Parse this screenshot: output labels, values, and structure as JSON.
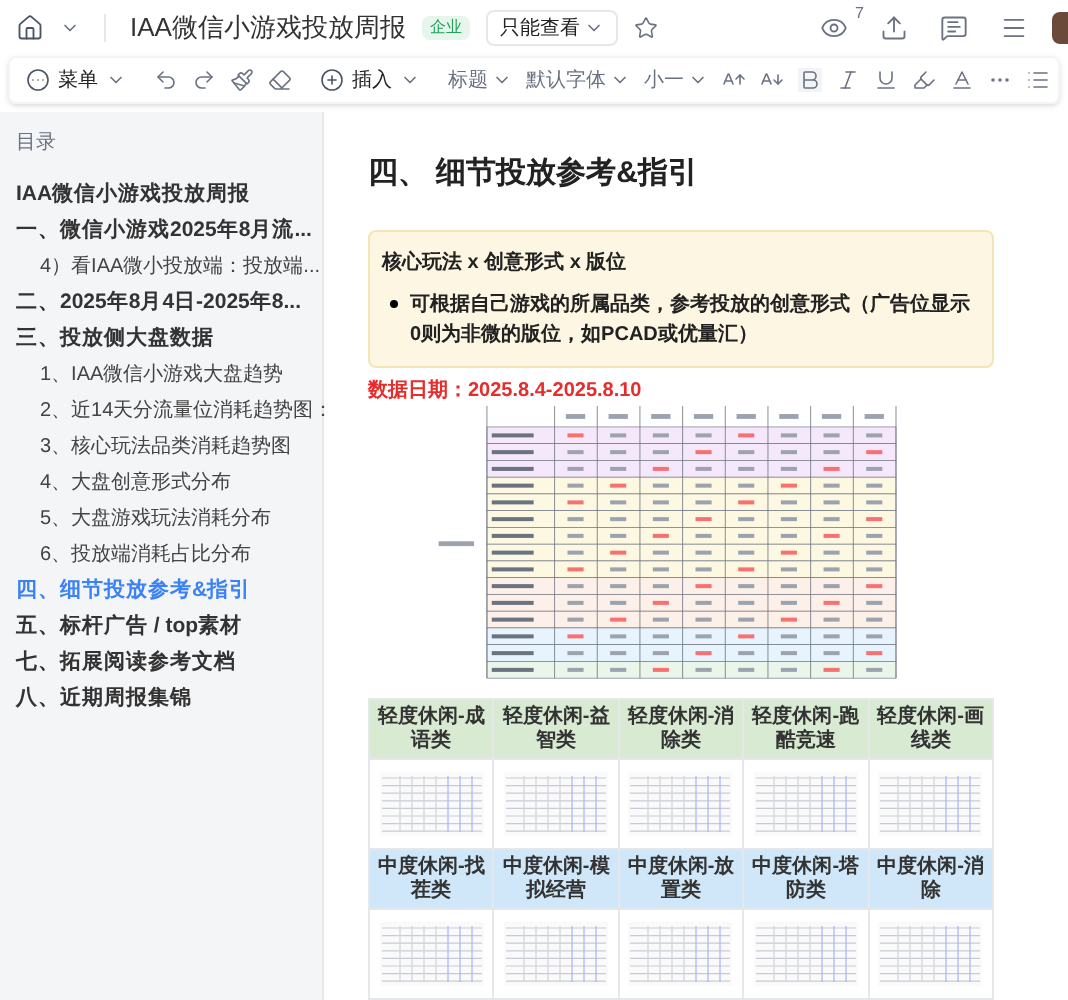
{
  "topbar": {
    "title": "IAA微信小游戏投放周报",
    "badge": "企业",
    "view_mode": "只能查看",
    "viewer_count": "7"
  },
  "toolbar": {
    "menu_label": "菜单",
    "insert_label": "插入",
    "style_fields": [
      {
        "value": "标题",
        "disabled": true
      },
      {
        "value": "默认字体",
        "disabled": true
      },
      {
        "value": "小一",
        "disabled": true
      }
    ]
  },
  "sidebar": {
    "title": "目录",
    "items": [
      {
        "label": "IAA微信小游戏投放周报",
        "selected": false
      },
      {
        "label": "一、微信小游戏2025年8月流...",
        "selected": false,
        "children": [
          {
            "label": "4）看IAA微小投放端：投放端...",
            "selected": false
          }
        ]
      },
      {
        "label": "二、2025年8月4日-2025年8...",
        "selected": false
      },
      {
        "label": "三、投放侧大盘数据",
        "selected": false,
        "children": [
          {
            "label": "1、IAA微信小游戏大盘趋势",
            "selected": false
          },
          {
            "label": "2、近14天分流量位消耗趋势图：",
            "selected": false
          },
          {
            "label": "3、核心玩法品类消耗趋势图",
            "selected": false
          },
          {
            "label": "4、大盘创意形式分布",
            "selected": false
          },
          {
            "label": "5、大盘游戏玩法消耗分布",
            "selected": false
          },
          {
            "label": "6、投放端消耗占比分布",
            "selected": false
          }
        ]
      },
      {
        "label": "四、细节投放参考&指引",
        "selected": true
      },
      {
        "label": "五、标杆广告 / top素材",
        "selected": false
      },
      {
        "label": "七、拓展阅读参考文档",
        "selected": false
      },
      {
        "label": "八、近期周报集锦",
        "selected": false
      }
    ]
  },
  "content": {
    "heading": "四、 细节投放参考&指引",
    "callout": {
      "title": "核心玩法 x 创意形式 x 版位",
      "bullets": [
        "可根据自己游戏的所属品类，参考投放的创意形式（广告位显示0则为非微的版位，如PCAD或优量汇）"
      ]
    },
    "date_line": "数据日期：2025.8.4-2025.8.10",
    "category_grid": {
      "rows": [
        {
          "color": "#d9ead3",
          "cells": [
            "轻度休闲-成语类",
            "轻度休闲-益智类",
            "轻度休闲-消除类",
            "轻度休闲-跑酷竞速",
            "轻度休闲-画线类"
          ]
        },
        {
          "color": "#cfe7f8",
          "cells": [
            "中度休闲-找茬类",
            "中度休闲-模拟经营",
            "中度休闲-放置类",
            "中度休闲-塔防类",
            "中度休闲-消除"
          ]
        }
      ]
    }
  }
}
